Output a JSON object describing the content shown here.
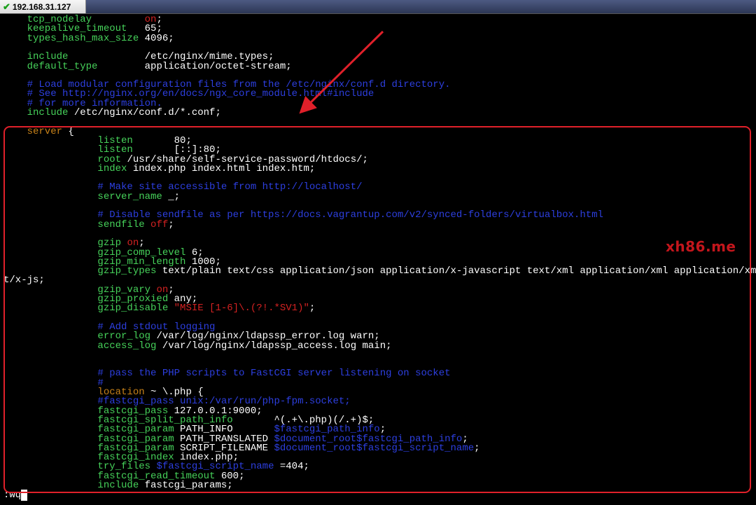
{
  "tab": {
    "title": "192.168.31.127",
    "status": "check-icon"
  },
  "watermark": "xh86.me",
  "status_line": ":wq",
  "colors": {
    "keyword": "#46d25a",
    "comment": "#2d3fe0",
    "string": "#d42222",
    "server": "#c88219",
    "annotation": "#e0202a"
  },
  "lines": [
    [
      [
        "kw",
        "    tcp_nodelay         "
      ],
      [
        "str",
        "on"
      ],
      [
        "val",
        ";"
      ]
    ],
    [
      [
        "kw",
        "    keepalive_timeout   "
      ],
      [
        "val",
        "65;"
      ]
    ],
    [
      [
        "kw",
        "    types_hash_max_size "
      ],
      [
        "val",
        "4096;"
      ]
    ],
    [],
    [
      [
        "kw",
        "    include             "
      ],
      [
        "val",
        "/etc/nginx/mime.types;"
      ]
    ],
    [
      [
        "kw",
        "    default_type        "
      ],
      [
        "val",
        "application/octet-stream;"
      ]
    ],
    [],
    [
      [
        "com",
        "    # Load modular configuration files from the /etc/nginx/conf.d directory."
      ]
    ],
    [
      [
        "com",
        "    # See http://nginx.org/en/docs/ngx_core_module.html#include"
      ]
    ],
    [
      [
        "com",
        "    # for more information."
      ]
    ],
    [
      [
        "kw",
        "    include "
      ],
      [
        "val",
        "/etc/nginx/conf.d/*.conf;"
      ]
    ],
    [],
    [
      [
        "brw",
        "    server "
      ],
      [
        "val",
        "{"
      ]
    ],
    [
      [
        "kw",
        "                listen       "
      ],
      [
        "val",
        "80;"
      ]
    ],
    [
      [
        "kw",
        "                listen       "
      ],
      [
        "val",
        "[::]:80;"
      ]
    ],
    [
      [
        "kw",
        "                root "
      ],
      [
        "val",
        "/usr/share/self-service-password/htdocs/;"
      ]
    ],
    [
      [
        "kw",
        "                index "
      ],
      [
        "val",
        "index.php index.html index.htm;"
      ]
    ],
    [],
    [
      [
        "com",
        "                # Make site accessible from http://localhost/"
      ]
    ],
    [
      [
        "kw",
        "                server_name "
      ],
      [
        "val",
        "_;"
      ]
    ],
    [],
    [
      [
        "com",
        "                # Disable sendfile as per https://docs.vagrantup.com/v2/synced-folders/virtualbox.html"
      ]
    ],
    [
      [
        "kw",
        "                sendfile "
      ],
      [
        "str",
        "off"
      ],
      [
        "val",
        ";"
      ]
    ],
    [],
    [
      [
        "kw",
        "                gzip "
      ],
      [
        "str",
        "on"
      ],
      [
        "val",
        ";"
      ]
    ],
    [
      [
        "kw",
        "                gzip_comp_level "
      ],
      [
        "val",
        "6;"
      ]
    ],
    [
      [
        "kw",
        "                gzip_min_length "
      ],
      [
        "val",
        "1000;"
      ]
    ],
    [
      [
        "kw",
        "                gzip_types "
      ],
      [
        "val",
        "text/plain text/css application/json application/x-javascript text/xml application/xml application/xml+rss text/javascript application/javascript tex"
      ]
    ],
    [
      [
        "val",
        "t/x-js;"
      ]
    ],
    [
      [
        "kw",
        "                gzip_vary "
      ],
      [
        "str",
        "on"
      ],
      [
        "val",
        ";"
      ]
    ],
    [
      [
        "kw",
        "                gzip_proxied "
      ],
      [
        "val",
        "any;"
      ]
    ],
    [
      [
        "kw",
        "                gzip_disable "
      ],
      [
        "str",
        "\"MSIE [1-6]\\.(?!.*SV1)\""
      ],
      [
        "val",
        ";"
      ]
    ],
    [],
    [
      [
        "com",
        "                # Add stdout logging"
      ]
    ],
    [
      [
        "kw",
        "                error_log "
      ],
      [
        "val",
        "/var/log/nginx/ldapssp_error.log warn;"
      ]
    ],
    [
      [
        "kw",
        "                access_log "
      ],
      [
        "val",
        "/var/log/nginx/ldapssp_access.log main;"
      ]
    ],
    [],
    [],
    [
      [
        "com",
        "                # pass the PHP scripts to FastCGI server listening on socket"
      ]
    ],
    [
      [
        "com",
        "                #"
      ]
    ],
    [
      [
        "brw",
        "                location "
      ],
      [
        "val",
        "~ \\.php {"
      ]
    ],
    [
      [
        "com",
        "                #fastcgi_pass unix:/var/run/php-fpm.socket;"
      ]
    ],
    [
      [
        "kw",
        "                fastcgi_pass "
      ],
      [
        "val",
        "127.0.0.1:9000;"
      ]
    ],
    [
      [
        "kw",
        "                fastcgi_split_path_info       "
      ],
      [
        "val",
        "^(.+\\.php)(/.+)$;"
      ]
    ],
    [
      [
        "kw",
        "                fastcgi_param "
      ],
      [
        "val",
        "PATH_INFO       "
      ],
      [
        "com",
        "$fastcgi_path_info"
      ],
      [
        "val",
        ";"
      ]
    ],
    [
      [
        "kw",
        "                fastcgi_param "
      ],
      [
        "val",
        "PATH_TRANSLATED "
      ],
      [
        "com",
        "$document_root$fastcgi_path_info"
      ],
      [
        "val",
        ";"
      ]
    ],
    [
      [
        "kw",
        "                fastcgi_param "
      ],
      [
        "val",
        "SCRIPT_FILENAME "
      ],
      [
        "com",
        "$document_root$fastcgi_script_name"
      ],
      [
        "val",
        ";"
      ]
    ],
    [
      [
        "kw",
        "                fastcgi_index "
      ],
      [
        "val",
        "index.php;"
      ]
    ],
    [
      [
        "kw",
        "                try_files "
      ],
      [
        "com",
        "$fastcgi_script_name "
      ],
      [
        "val",
        "=404;"
      ]
    ],
    [
      [
        "kw",
        "                fastcgi_read_timeout "
      ],
      [
        "val",
        "600;"
      ]
    ],
    [
      [
        "kw",
        "                include "
      ],
      [
        "val",
        "fastcgi_params;"
      ]
    ]
  ]
}
